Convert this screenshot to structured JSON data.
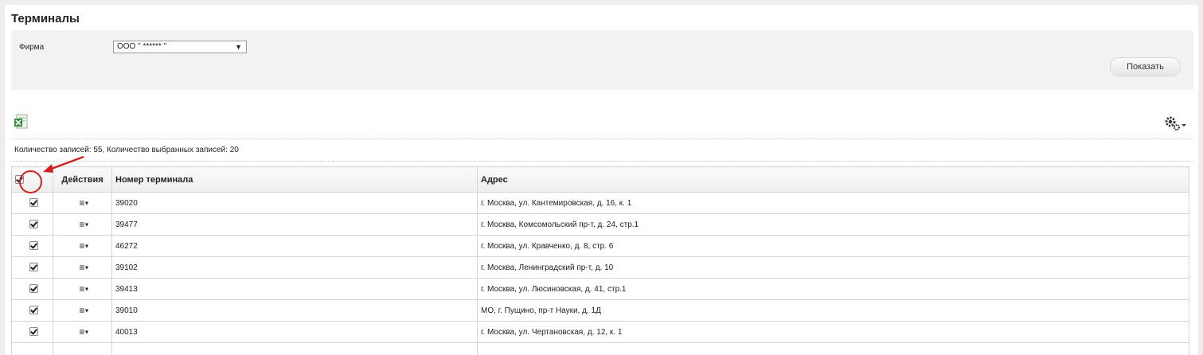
{
  "page_title": "Терминалы",
  "filter": {
    "firm_label": "Фирма",
    "firm_value": "ООО \"  ******  \"",
    "show_button": "Показать"
  },
  "toolbar": {
    "export_icon": "excel-export-icon",
    "settings_icon": "gear-icon"
  },
  "records_info": "Количество записей: 55, Количество выбранных записей: 20",
  "table": {
    "columns": [
      "Действия",
      "Номер терминала",
      "Адрес"
    ],
    "rows": [
      {
        "number": "39020",
        "address": "г. Москва, ул. Кантемировская, д. 16, к. 1"
      },
      {
        "number": "39477",
        "address": "г. Москва, Комсомольский пр-т, д. 24, стр.1"
      },
      {
        "number": "46272",
        "address": "г. Москва, ул. Кравченко, д. 8, стр. 6"
      },
      {
        "number": "39102",
        "address": "г. Москва, Ленинградский пр-т, д. 10"
      },
      {
        "number": "39413",
        "address": "г. Москва, ул. Люсиновская, д. 41, стр.1"
      },
      {
        "number": "39010",
        "address": "МО, г. Пущино, пр-т Науки, д. 1Д"
      },
      {
        "number": "40013",
        "address": "г. Москва, ул. Чертановская, д. 12, к. 1"
      }
    ]
  },
  "colors": {
    "annotation": "#d42020",
    "filter_bg": "#f2f2f2"
  }
}
